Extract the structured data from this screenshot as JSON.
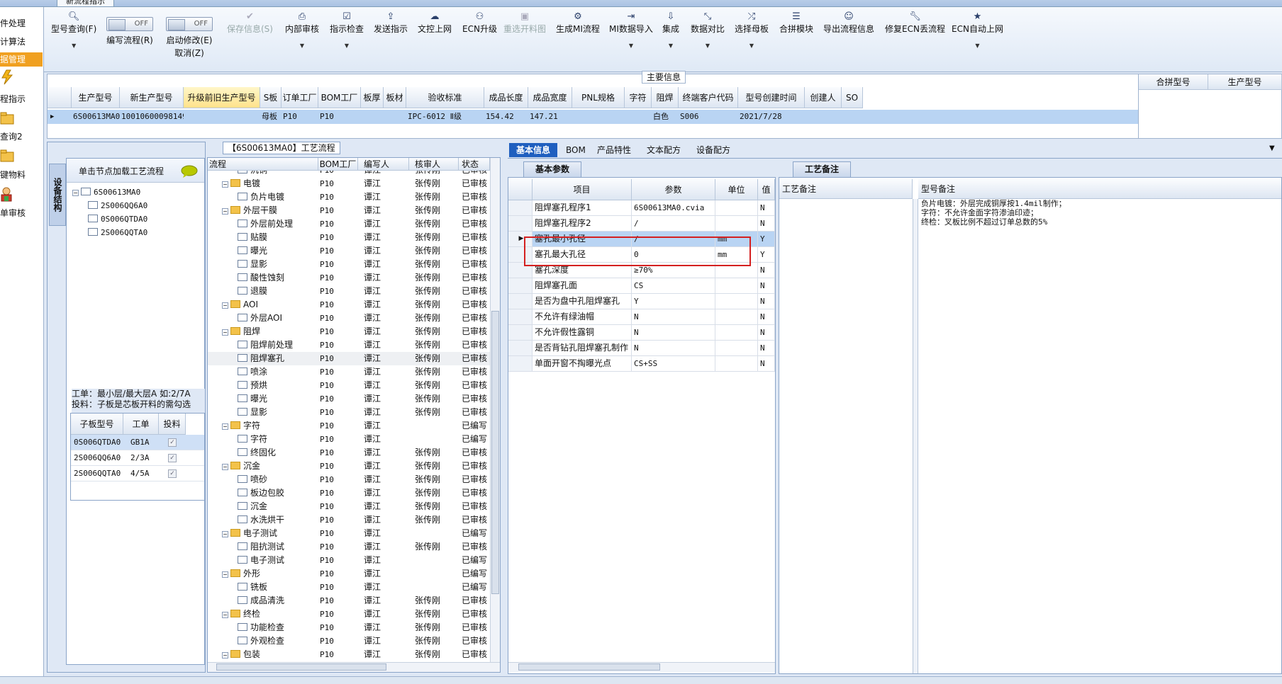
{
  "window": {
    "tab_title": "新流程指示"
  },
  "left_nav": {
    "items": [
      {
        "label": "件处理"
      },
      {
        "label": "计算法"
      },
      {
        "label": "据管理"
      },
      {
        "label": "程指示"
      },
      {
        "label": "查询2"
      },
      {
        "label": "键物料"
      },
      {
        "label": "单审核"
      }
    ]
  },
  "ribbon": {
    "model_query": "型号查询(F)",
    "write_flow": "编写流程(R)",
    "write_flow_toggle": "OFF",
    "auto_modify": "启动修改(E)",
    "auto_modify_toggle": "OFF",
    "cancel": "取消(Z)",
    "save_info": "保存信息(S)",
    "internal_review": "内部审核",
    "instruction_check": "指示检查",
    "send_instruction": "发送指示",
    "doc_upload": "文控上网",
    "ecn_upgrade": "ECN升级",
    "reselect_layout": "重选开料图",
    "gen_mi_flow": "生成MI流程",
    "mi_import": "MI数据导入",
    "integrate": "集成",
    "data_compare": "数据对比",
    "select_mother": "选择母板",
    "merge_module": "合拼模块",
    "export_flow": "导出流程信息",
    "fix_ecn": "修复ECN丢流程",
    "ecn_auto_upload": "ECN自动上网"
  },
  "main_info": {
    "title": "主要信息",
    "columns": [
      "生产型号",
      "新生产型号",
      "升级前旧生产型号",
      "S板",
      "订单工厂",
      "BOM工厂",
      "板厚",
      "板材",
      "验收标准",
      "成品长度",
      "成品宽度",
      "PNL规格",
      "字符",
      "阻焊",
      "终端客户代码",
      "型号创建时间",
      "创建人",
      "SO"
    ],
    "row": [
      "6S00613MA0",
      "10010600098149",
      "",
      "母板",
      "P10",
      "P10",
      "",
      "",
      "IPC-6012 Ⅱ级",
      "154.42",
      "147.21",
      "",
      "",
      "白色",
      "S006",
      "2021/7/28",
      "",
      ""
    ],
    "merge_columns": [
      "合拼型号",
      "生产型号"
    ]
  },
  "structure_panel": {
    "vertical_tab": "设备结构",
    "load_hint": "单击节点加载工艺流程",
    "root": "6S00613MA0",
    "children": [
      "2S006QQ6A0",
      "0S006QTDA0",
      "2S006QQTA0"
    ],
    "note1": "工单：最小层/最大层A 如:2/7A",
    "note2": "投料：子板是芯板开料的需勾选",
    "sub_columns": [
      "子板型号",
      "工单",
      "投料"
    ],
    "sub_rows": [
      {
        "model": "0S006QTDA0",
        "order": "GB1A",
        "checked": true
      },
      {
        "model": "2S006QQ6A0",
        "order": "2/3A",
        "checked": true
      },
      {
        "model": "2S006QQTA0",
        "order": "4/5A",
        "checked": true
      }
    ]
  },
  "flow_panel": {
    "title": "【6S00613MA0】工艺流程",
    "columns": [
      "流程",
      "BOM工厂",
      "编写人",
      "核审人",
      "状态"
    ],
    "rows": [
      {
        "name": "沉铜",
        "level": 2,
        "factory": "P10",
        "writer": "谭江",
        "reviewer": "张传刚",
        "status": "已审核"
      },
      {
        "name": "电镀",
        "level": 1,
        "factory": "P10",
        "writer": "谭江",
        "reviewer": "张传刚",
        "status": "已审核"
      },
      {
        "name": "负片电镀",
        "level": 2,
        "factory": "P10",
        "writer": "谭江",
        "reviewer": "张传刚",
        "status": "已审核"
      },
      {
        "name": "外层干膜",
        "level": 1,
        "factory": "P10",
        "writer": "谭江",
        "reviewer": "张传刚",
        "status": "已审核"
      },
      {
        "name": "外层前处理",
        "level": 2,
        "factory": "P10",
        "writer": "谭江",
        "reviewer": "张传刚",
        "status": "已审核"
      },
      {
        "name": "贴膜",
        "level": 2,
        "factory": "P10",
        "writer": "谭江",
        "reviewer": "张传刚",
        "status": "已审核"
      },
      {
        "name": "曝光",
        "level": 2,
        "factory": "P10",
        "writer": "谭江",
        "reviewer": "张传刚",
        "status": "已审核"
      },
      {
        "name": "显影",
        "level": 2,
        "factory": "P10",
        "writer": "谭江",
        "reviewer": "张传刚",
        "status": "已审核"
      },
      {
        "name": "酸性蚀刻",
        "level": 2,
        "factory": "P10",
        "writer": "谭江",
        "reviewer": "张传刚",
        "status": "已审核"
      },
      {
        "name": "退膜",
        "level": 2,
        "factory": "P10",
        "writer": "谭江",
        "reviewer": "张传刚",
        "status": "已审核"
      },
      {
        "name": "AOI",
        "level": 1,
        "factory": "P10",
        "writer": "谭江",
        "reviewer": "张传刚",
        "status": "已审核"
      },
      {
        "name": "外层AOI",
        "level": 2,
        "factory": "P10",
        "writer": "谭江",
        "reviewer": "张传刚",
        "status": "已审核"
      },
      {
        "name": "阻焊",
        "level": 1,
        "factory": "P10",
        "writer": "谭江",
        "reviewer": "张传刚",
        "status": "已审核"
      },
      {
        "name": "阻焊前处理",
        "level": 2,
        "factory": "P10",
        "writer": "谭江",
        "reviewer": "张传刚",
        "status": "已审核"
      },
      {
        "name": "阻焊塞孔",
        "level": 2,
        "factory": "P10",
        "writer": "谭江",
        "reviewer": "张传刚",
        "status": "已审核",
        "selected": true
      },
      {
        "name": "喷涂",
        "level": 2,
        "factory": "P10",
        "writer": "谭江",
        "reviewer": "张传刚",
        "status": "已审核"
      },
      {
        "name": "预烘",
        "level": 2,
        "factory": "P10",
        "writer": "谭江",
        "reviewer": "张传刚",
        "status": "已审核"
      },
      {
        "name": "曝光",
        "level": 2,
        "factory": "P10",
        "writer": "谭江",
        "reviewer": "张传刚",
        "status": "已审核"
      },
      {
        "name": "显影",
        "level": 2,
        "factory": "P10",
        "writer": "谭江",
        "reviewer": "张传刚",
        "status": "已审核"
      },
      {
        "name": "字符",
        "level": 1,
        "factory": "P10",
        "writer": "谭江",
        "reviewer": "",
        "status": "已编写"
      },
      {
        "name": "字符",
        "level": 2,
        "factory": "P10",
        "writer": "谭江",
        "reviewer": "",
        "status": "已编写"
      },
      {
        "name": "终固化",
        "level": 2,
        "factory": "P10",
        "writer": "谭江",
        "reviewer": "张传刚",
        "status": "已审核"
      },
      {
        "name": "沉金",
        "level": 1,
        "factory": "P10",
        "writer": "谭江",
        "reviewer": "张传刚",
        "status": "已审核"
      },
      {
        "name": "喷砂",
        "level": 2,
        "factory": "P10",
        "writer": "谭江",
        "reviewer": "张传刚",
        "status": "已审核"
      },
      {
        "name": "板边包胶",
        "level": 2,
        "factory": "P10",
        "writer": "谭江",
        "reviewer": "张传刚",
        "status": "已审核"
      },
      {
        "name": "沉金",
        "level": 2,
        "factory": "P10",
        "writer": "谭江",
        "reviewer": "张传刚",
        "status": "已审核"
      },
      {
        "name": "水洗烘干",
        "level": 2,
        "factory": "P10",
        "writer": "谭江",
        "reviewer": "张传刚",
        "status": "已审核"
      },
      {
        "name": "电子测试",
        "level": 1,
        "factory": "P10",
        "writer": "谭江",
        "reviewer": "",
        "status": "已编写"
      },
      {
        "name": "阻抗测试",
        "level": 2,
        "factory": "P10",
        "writer": "谭江",
        "reviewer": "张传刚",
        "status": "已审核"
      },
      {
        "name": "电子测试",
        "level": 2,
        "factory": "P10",
        "writer": "谭江",
        "reviewer": "",
        "status": "已编写"
      },
      {
        "name": "外形",
        "level": 1,
        "factory": "P10",
        "writer": "谭江",
        "reviewer": "",
        "status": "已编写"
      },
      {
        "name": "铣板",
        "level": 2,
        "factory": "P10",
        "writer": "谭江",
        "reviewer": "",
        "status": "已编写"
      },
      {
        "name": "成品清洗",
        "level": 2,
        "factory": "P10",
        "writer": "谭江",
        "reviewer": "张传刚",
        "status": "已审核"
      },
      {
        "name": "终检",
        "level": 1,
        "factory": "P10",
        "writer": "谭江",
        "reviewer": "张传刚",
        "status": "已审核"
      },
      {
        "name": "功能检查",
        "level": 2,
        "factory": "P10",
        "writer": "谭江",
        "reviewer": "张传刚",
        "status": "已审核"
      },
      {
        "name": "外观检查",
        "level": 2,
        "factory": "P10",
        "writer": "谭江",
        "reviewer": "张传刚",
        "status": "已审核"
      },
      {
        "name": "包装",
        "level": 1,
        "factory": "P10",
        "writer": "谭江",
        "reviewer": "张传刚",
        "status": "已审核"
      }
    ]
  },
  "detail_tabs": [
    "基本信息",
    "BOM",
    "产品特性",
    "文本配方",
    "设备配方"
  ],
  "params_panel": {
    "section_title": "基本参数",
    "columns": [
      "项目",
      "参数",
      "单位",
      "值"
    ],
    "rows": [
      {
        "item": "阻焊塞孔程序1",
        "value": "6S00613MA0.cvia",
        "unit": "",
        "flag": "N"
      },
      {
        "item": "阻焊塞孔程序2",
        "value": "/",
        "unit": "",
        "flag": "N"
      },
      {
        "item": "塞孔最小孔径",
        "value": "/",
        "unit": "mm",
        "flag": "Y",
        "selected": true
      },
      {
        "item": "塞孔最大孔径",
        "value": "0",
        "unit": "mm",
        "flag": "Y"
      },
      {
        "item": "塞孔深度",
        "value": "≥70%",
        "unit": "",
        "flag": "N"
      },
      {
        "item": "阻焊塞孔面",
        "value": "CS",
        "unit": "",
        "flag": "N"
      },
      {
        "item": "是否为盘中孔阻焊塞孔",
        "value": "Y",
        "unit": "",
        "flag": "N"
      },
      {
        "item": "不允许有绿油帽",
        "value": "N",
        "unit": "",
        "flag": "N"
      },
      {
        "item": "不允许假性露铜",
        "value": "N",
        "unit": "",
        "flag": "N"
      },
      {
        "item": "是否背钻孔阻焊塞孔制作",
        "value": "N",
        "unit": "",
        "flag": "N"
      },
      {
        "item": "单面开窗不掏曝光点",
        "value": "CS+SS",
        "unit": "",
        "flag": "N"
      }
    ],
    "highlight_color": "#d42020"
  },
  "remark_panel": {
    "section_title": "工艺备注",
    "col1": "工艺备注",
    "col2": "型号备注",
    "model_remark_lines": [
      "负片电镀：外层完成铜厚按1.4mil制作；",
      "字符：不允许金面字符渗油印迹；",
      "终检：叉板比例不超过订单总数的5%"
    ]
  },
  "status_bar": {
    "text": ""
  }
}
